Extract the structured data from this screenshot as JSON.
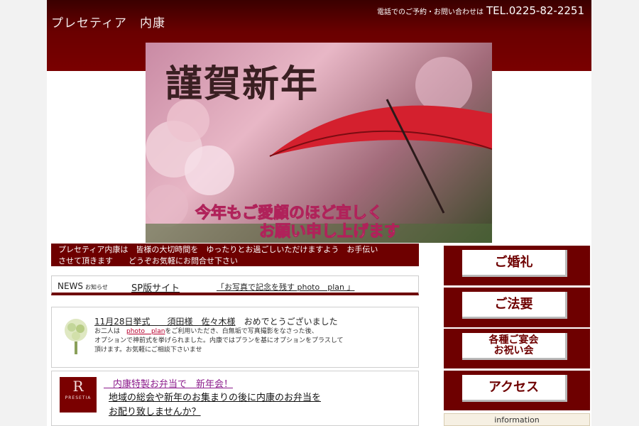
{
  "header": {
    "site_title": "プレセティア　内康",
    "contact_label": "電話でのご予約・お問い合わせは",
    "tel": "TEL.0225-82-2251"
  },
  "hero": {
    "title": "謹賀新年",
    "message_line1": "今年もご愛顧のほど宜しく",
    "message_line2": "お願い申し上げます"
  },
  "intro": {
    "line1": "プレセティア内康は　皆様の大切時間を　ゆったりとお過ごしいただけますよう　お手伝い",
    "line2": "させて頂きます　　どうぞお気軽にお問合せ下さい"
  },
  "newsbar": {
    "label": "NEWS",
    "label_sub": "お知らせ",
    "sp_link": "SP版サイト",
    "plan_link": "「お写真で記念を残す  photo　plan 」"
  },
  "news1": {
    "headline_date": "11月28日挙式　　須田様　佐々木様",
    "headline_msg": "おめでとうございました",
    "body_before": "お二人は　",
    "body_link": "photo　plan",
    "body_after": "をご利用いただき、白無垢で写真撮影をなさった後、",
    "body_line2": "オプションで神前式を挙げられました。内康ではプランを基にオプションをプラスして",
    "body_line3": "頂けます。お気軽にご相談下さいませ"
  },
  "news2": {
    "logo_letter": "R",
    "logo_name": "PRESETIA",
    "title": "　内康特製お弁当で　新年会！",
    "desc_line1": "地域の総会や新年のお集まりの後に内康のお弁当を",
    "desc_line2": "お配り致しませんか？"
  },
  "sidebar": {
    "wedding": "ご婚礼",
    "memorial": "ご法要",
    "banquet_line1": "各種ご宴会",
    "banquet_line2": "お祝い会",
    "access": "アクセス",
    "information": "information"
  },
  "colors": {
    "brand": "#6e0000",
    "link": "#b8002e"
  }
}
